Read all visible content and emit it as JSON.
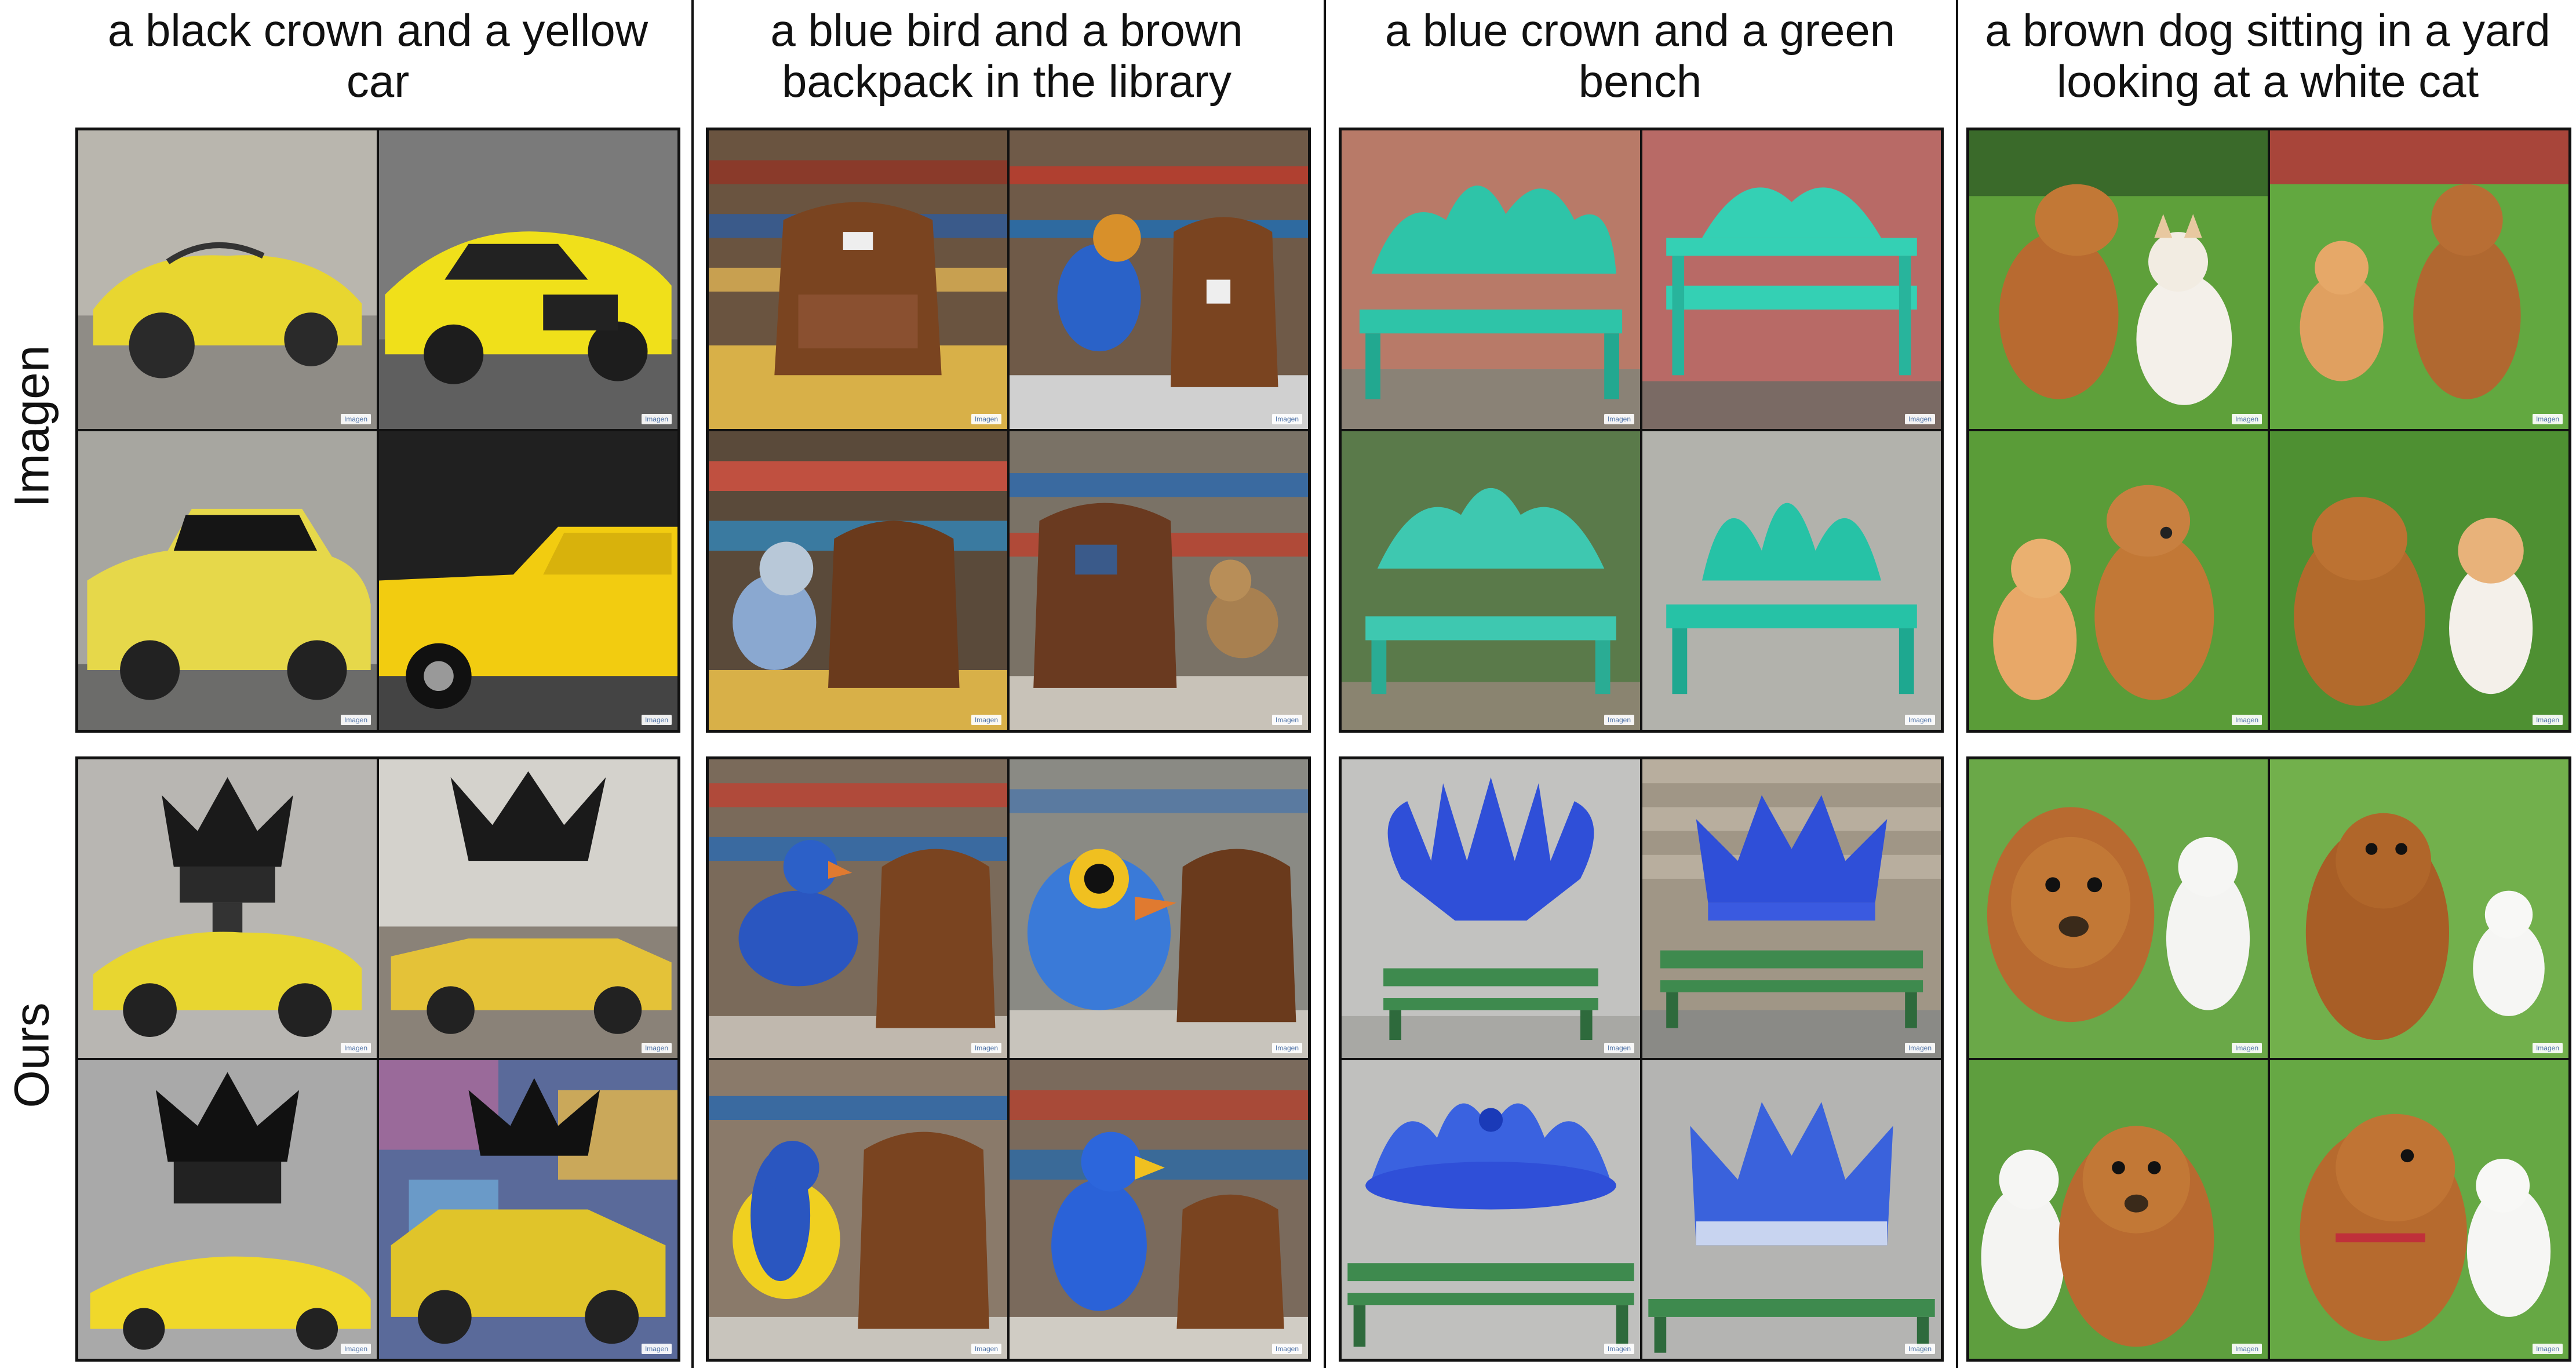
{
  "columns": [
    {
      "caption": "a black crown and a yellow car"
    },
    {
      "caption": "a blue bird and a brown backpack in the library"
    },
    {
      "caption": "a blue crown and a green bench"
    },
    {
      "caption": "a brown dog sitting in a yard looking at a white cat"
    }
  ],
  "rows": [
    {
      "label": "Imagen"
    },
    {
      "label": "Ours"
    }
  ],
  "watermark": "Imagen",
  "colors": {
    "yellow_car": "#e8d630",
    "black_crown": "#1a1a1a",
    "blue_bird": "#2a62c8",
    "brown_backpack": "#7a4420",
    "teal_bench": "#2ec4a8",
    "blue_crown": "#2f4fd8",
    "green_bench": "#3e8a4e",
    "brown_dog": "#b86a30",
    "white_cat": "#f2f2f0",
    "grass": "#5ea03a"
  }
}
